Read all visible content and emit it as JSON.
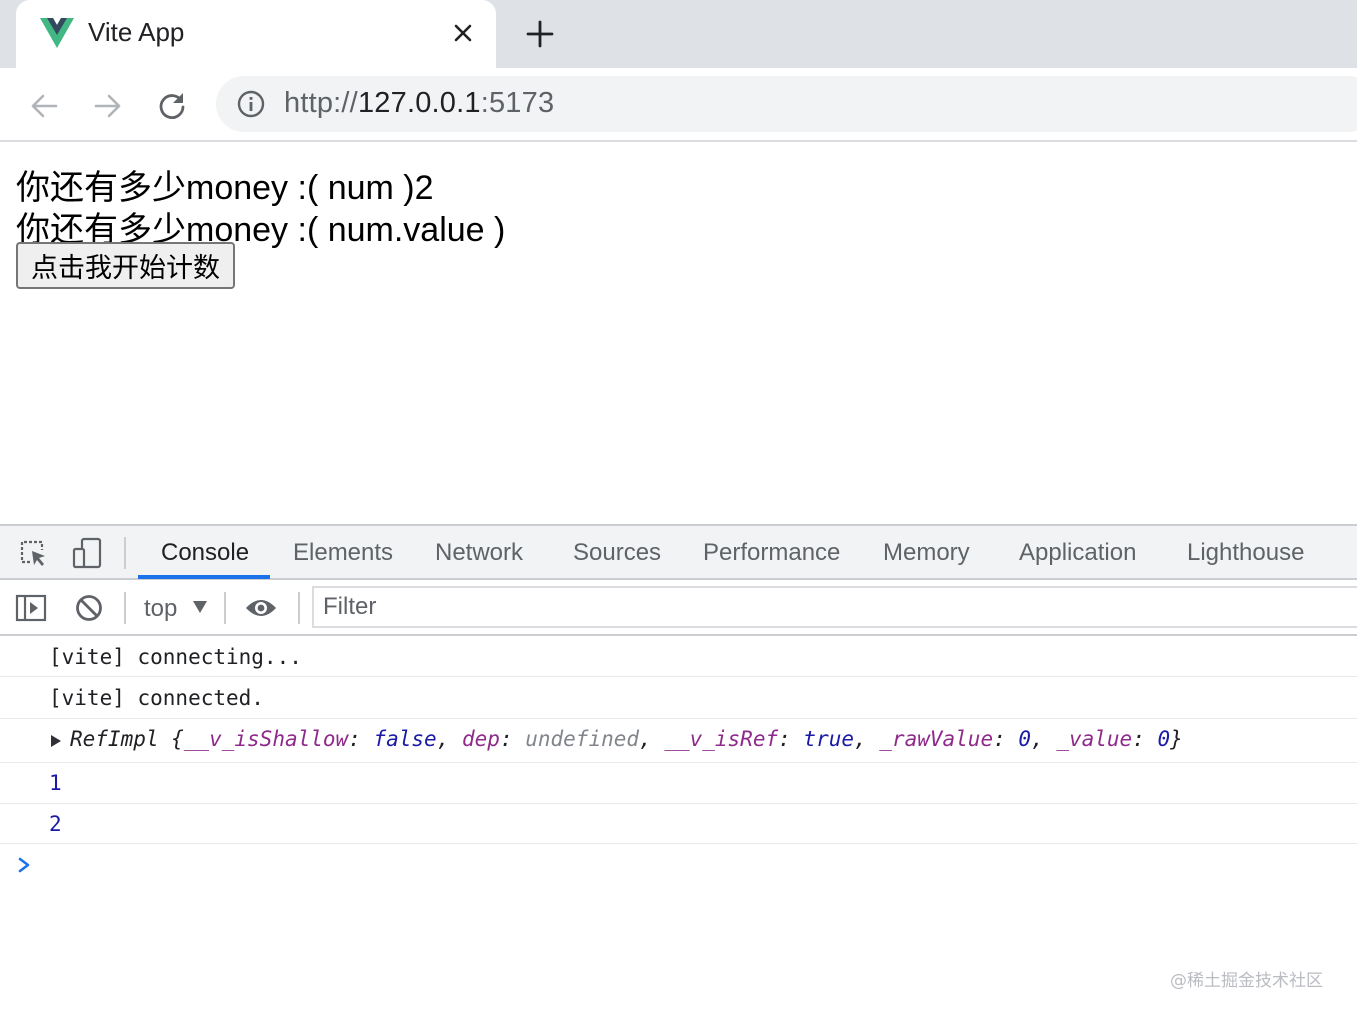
{
  "browser": {
    "tab": {
      "title": "Vite App",
      "favicon": "vue-logo-icon"
    },
    "address": {
      "scheme": "http://",
      "host": "127.0.0.1",
      "port": ":5173"
    }
  },
  "page": {
    "line1": "你还有多少money :( num )2",
    "line2": "你还有多少money :( num.value )",
    "button_label": "点击我开始计数"
  },
  "devtools": {
    "tabs": [
      "Console",
      "Elements",
      "Network",
      "Sources",
      "Performance",
      "Memory",
      "Application",
      "Lighthouse"
    ],
    "active_tab": "Console",
    "context": "top",
    "filter_placeholder": "Filter",
    "logs": {
      "connecting": "[vite] connecting...",
      "connected": "[vite] connected.",
      "refimpl": {
        "type": "RefImpl",
        "open": " {",
        "k1": "__v_isShallow",
        "v1": "false",
        "k2": "dep",
        "v2": "undefined",
        "k3": "__v_isRef",
        "v3": "true",
        "k4": "_rawValue",
        "v4": "0",
        "k5": "_value",
        "v5": "0",
        "close": "}"
      },
      "value1": "1",
      "value2": "2"
    }
  },
  "watermark": "@稀土掘金技术社区",
  "colors": {
    "accent": "#1a73e8",
    "vue_green": "#41b883",
    "vue_dark": "#34495e"
  }
}
